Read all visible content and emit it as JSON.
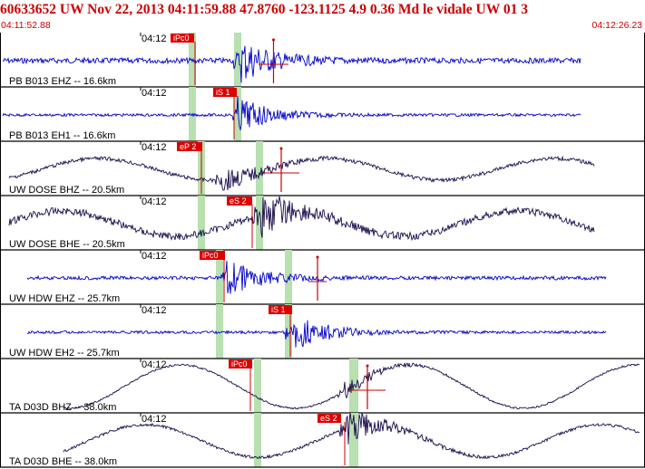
{
  "header": {
    "event_line": "60633652 UW Nov 22, 2013 04:11:59.88   47.8760 -123.1125  4.9 0.36 Md le vidale UW 01   3",
    "start_time": "04:11:52.88",
    "end_time": "04:12:26.23"
  },
  "colors": {
    "header_text": "#cc0000",
    "blue_trace": "#0000cc",
    "purple_trace": "#1a0a4a",
    "pick_fill": "#dd0000",
    "window_fill": "#b8e0b0"
  },
  "traces": [
    {
      "label": "PB B013 EHZ -- 16.6km",
      "minute_tick": "04:12",
      "pick": "iPc0",
      "color": "blue"
    },
    {
      "label": "PB B013 EH1 -- 16.6km",
      "minute_tick": "04:12",
      "pick": "iS 1",
      "color": "blue"
    },
    {
      "label": "UW DOSE BHZ -- 20.5km",
      "minute_tick": "04:12",
      "pick": "eP 2",
      "color": "purple"
    },
    {
      "label": "UW DOSE BHE -- 20.5km",
      "minute_tick": "04:12",
      "pick": "eS 2",
      "color": "purple"
    },
    {
      "label": "UW HDW EHZ -- 25.7km",
      "minute_tick": "04:12",
      "pick": "iPc0",
      "color": "blue"
    },
    {
      "label": "UW HDW EH2 -- 25.7km",
      "minute_tick": "04:12",
      "pick": "iS 1",
      "color": "blue"
    },
    {
      "label": "TA D03D BHZ -- 38.0km",
      "minute_tick": "04:12",
      "pick": "iPc0",
      "color": "purple"
    },
    {
      "label": "TA D03D BHE -- 38.0km",
      "minute_tick": "04:12",
      "pick": "eS 2",
      "color": "purple"
    }
  ]
}
